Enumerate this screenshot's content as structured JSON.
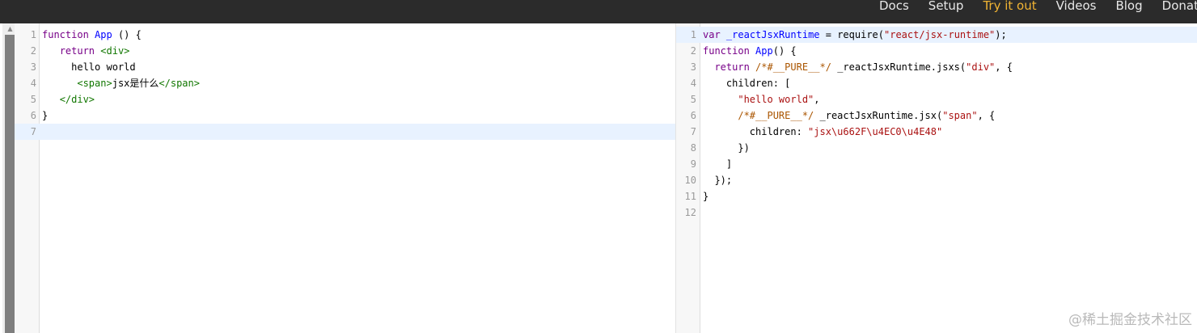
{
  "nav": {
    "items": [
      {
        "label": "Docs",
        "active": false
      },
      {
        "label": "Setup",
        "active": false
      },
      {
        "label": "Try it out",
        "active": true
      },
      {
        "label": "Videos",
        "active": false
      },
      {
        "label": "Blog",
        "active": false
      },
      {
        "label": "Donate",
        "active": false
      }
    ],
    "colors": {
      "background": "#2b2b2b",
      "text": "#e8e8e8",
      "active": "#f1b433"
    }
  },
  "input_editor": {
    "line_numbers": [
      "1",
      "2",
      "3",
      "4",
      "5",
      "6",
      "7"
    ],
    "active_line": 7,
    "lines": [
      [
        {
          "t": "function",
          "c": "kw"
        },
        {
          "t": " "
        },
        {
          "t": "App",
          "c": "def"
        },
        {
          "t": " () {"
        }
      ],
      [
        {
          "t": "   "
        },
        {
          "t": "return",
          "c": "kw"
        },
        {
          "t": " "
        },
        {
          "t": "<div>",
          "c": "tag"
        }
      ],
      [
        {
          "t": "     hello world"
        }
      ],
      [
        {
          "t": "      "
        },
        {
          "t": "<span>",
          "c": "tag"
        },
        {
          "t": "jsx是什么"
        },
        {
          "t": "</span>",
          "c": "tag"
        }
      ],
      [
        {
          "t": "   "
        },
        {
          "t": "</div>",
          "c": "tag"
        }
      ],
      [
        {
          "t": "}"
        }
      ],
      []
    ]
  },
  "output_editor": {
    "line_numbers": [
      "1",
      "2",
      "3",
      "4",
      "5",
      "6",
      "7",
      "8",
      "9",
      "10",
      "11",
      "12"
    ],
    "active_line": 1,
    "lines": [
      [
        {
          "t": "var",
          "c": "kw"
        },
        {
          "t": " "
        },
        {
          "t": "_reactJsxRuntime",
          "c": "def"
        },
        {
          "t": " = require("
        },
        {
          "t": "\"react/jsx-runtime\"",
          "c": "str"
        },
        {
          "t": ");"
        }
      ],
      [
        {
          "t": "function",
          "c": "kw"
        },
        {
          "t": " "
        },
        {
          "t": "App",
          "c": "def"
        },
        {
          "t": "() {"
        }
      ],
      [
        {
          "t": "  "
        },
        {
          "t": "return",
          "c": "kw"
        },
        {
          "t": " "
        },
        {
          "t": "/*#__PURE__*/",
          "c": "cmt"
        },
        {
          "t": " _reactJsxRuntime.jsxs("
        },
        {
          "t": "\"div\"",
          "c": "str"
        },
        {
          "t": ", {"
        }
      ],
      [
        {
          "t": "    children: ["
        }
      ],
      [
        {
          "t": "      "
        },
        {
          "t": "\"hello world\"",
          "c": "str"
        },
        {
          "t": ","
        }
      ],
      [
        {
          "t": "      "
        },
        {
          "t": "/*#__PURE__*/",
          "c": "cmt"
        },
        {
          "t": " _reactJsxRuntime.jsx("
        },
        {
          "t": "\"span\"",
          "c": "str"
        },
        {
          "t": ", {"
        }
      ],
      [
        {
          "t": "        children: "
        },
        {
          "t": "\"jsx\\u662F\\u4EC0\\u4E48\"",
          "c": "str"
        }
      ],
      [
        {
          "t": "      })"
        }
      ],
      [
        {
          "t": "    ]"
        }
      ],
      [
        {
          "t": "  });"
        }
      ],
      [
        {
          "t": "}"
        }
      ],
      []
    ]
  },
  "watermark": "@稀土掘金技术社区",
  "scroll_arrow_icon": "triangle-up"
}
